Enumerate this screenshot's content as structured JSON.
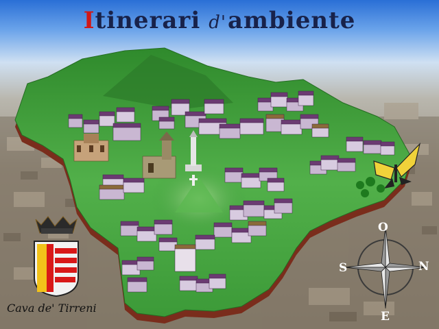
{
  "header": {
    "title_first": "I",
    "title_rest": "tinerari",
    "title_middle": "d'",
    "title_last": "ambiente"
  },
  "town": {
    "name": "Cava de' Tirreni"
  },
  "compass": {
    "n": "O",
    "s": "S",
    "e": "N",
    "w": "E"
  },
  "colors": {
    "title": "#18224a",
    "accent": "#d01818",
    "map_green": "#3d9e3a",
    "roofs": "#6b3b72"
  }
}
